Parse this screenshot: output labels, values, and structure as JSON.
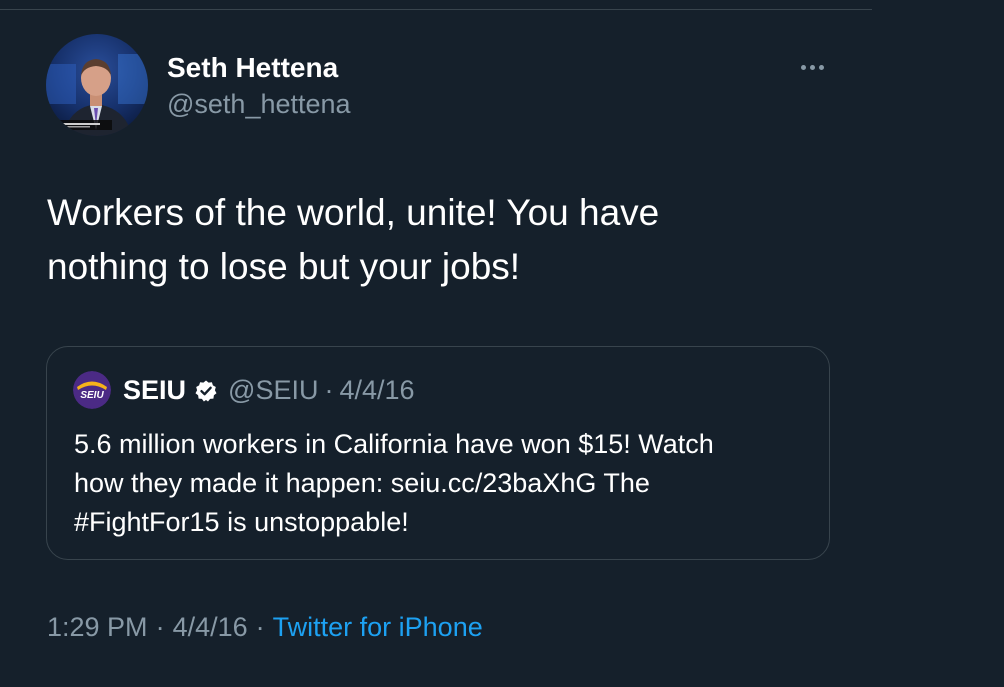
{
  "tweet": {
    "author": {
      "display_name": "Seth Hettena",
      "handle": "@seth_hettena",
      "avatar_icon": "profile-photo-avatar"
    },
    "text": "Workers of the world, unite!  You have\nnothing to lose but your jobs!",
    "more_icon": "more-horizontal-icon",
    "quoted": {
      "display_name": "SEIU",
      "verified": true,
      "handle": "@SEIU",
      "separator": "·",
      "date": "4/4/16",
      "logo_icon": "seiu-logo",
      "logo_text": "SEIU",
      "text": "5.6 million workers in California have won $15! Watch\nhow they made it happen: seiu.cc/23baXhG The\n#FightFor15 is unstoppable!"
    },
    "meta": {
      "time": "1:29 PM",
      "separator": "·",
      "date": "4/4/16",
      "source": "Twitter for iPhone"
    }
  },
  "colors": {
    "background": "#15202b",
    "primary_text": "#ffffff",
    "secondary_text": "#8899a6",
    "link": "#1da1f2",
    "border": "#38444d",
    "seiu_purple": "#4b2a85",
    "seiu_gold": "#f5b21a"
  }
}
